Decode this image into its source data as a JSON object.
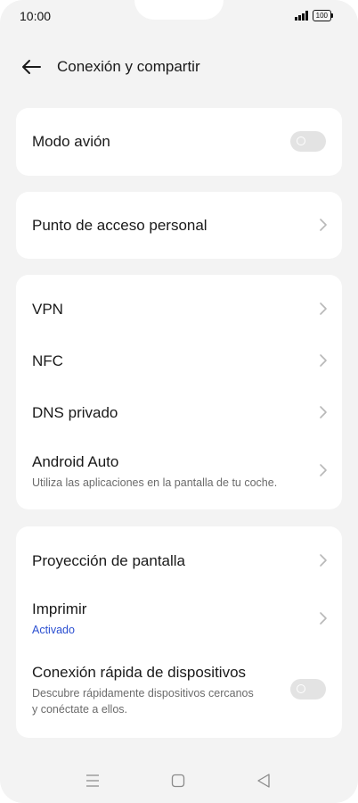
{
  "status_bar": {
    "time": "10:00",
    "battery": "100"
  },
  "header": {
    "title": "Conexión y compartir"
  },
  "sections": {
    "airplane": {
      "label": "Modo avión",
      "enabled": false
    },
    "hotspot": {
      "label": "Punto de acceso personal"
    },
    "vpn": {
      "label": "VPN"
    },
    "nfc": {
      "label": "NFC"
    },
    "dns": {
      "label": "DNS privado"
    },
    "android_auto": {
      "label": "Android Auto",
      "subtitle": "Utiliza las aplicaciones en la pantalla de tu coche."
    },
    "screencast": {
      "label": "Proyección de pantalla"
    },
    "print": {
      "label": "Imprimir",
      "subtitle": "Activado"
    },
    "quick_connect": {
      "label": "Conexión rápida de dispositivos",
      "subtitle_line1": "Descubre rápidamente dispositivos cercanos",
      "subtitle_line2": "y conéctate a ellos.",
      "enabled": false
    }
  },
  "colors": {
    "accent": "#2b4fd1",
    "background": "#f3f3f3",
    "card": "#ffffff"
  },
  "nav": {
    "icons": [
      "menu-icon",
      "home-square-icon",
      "back-triangle-icon"
    ]
  }
}
